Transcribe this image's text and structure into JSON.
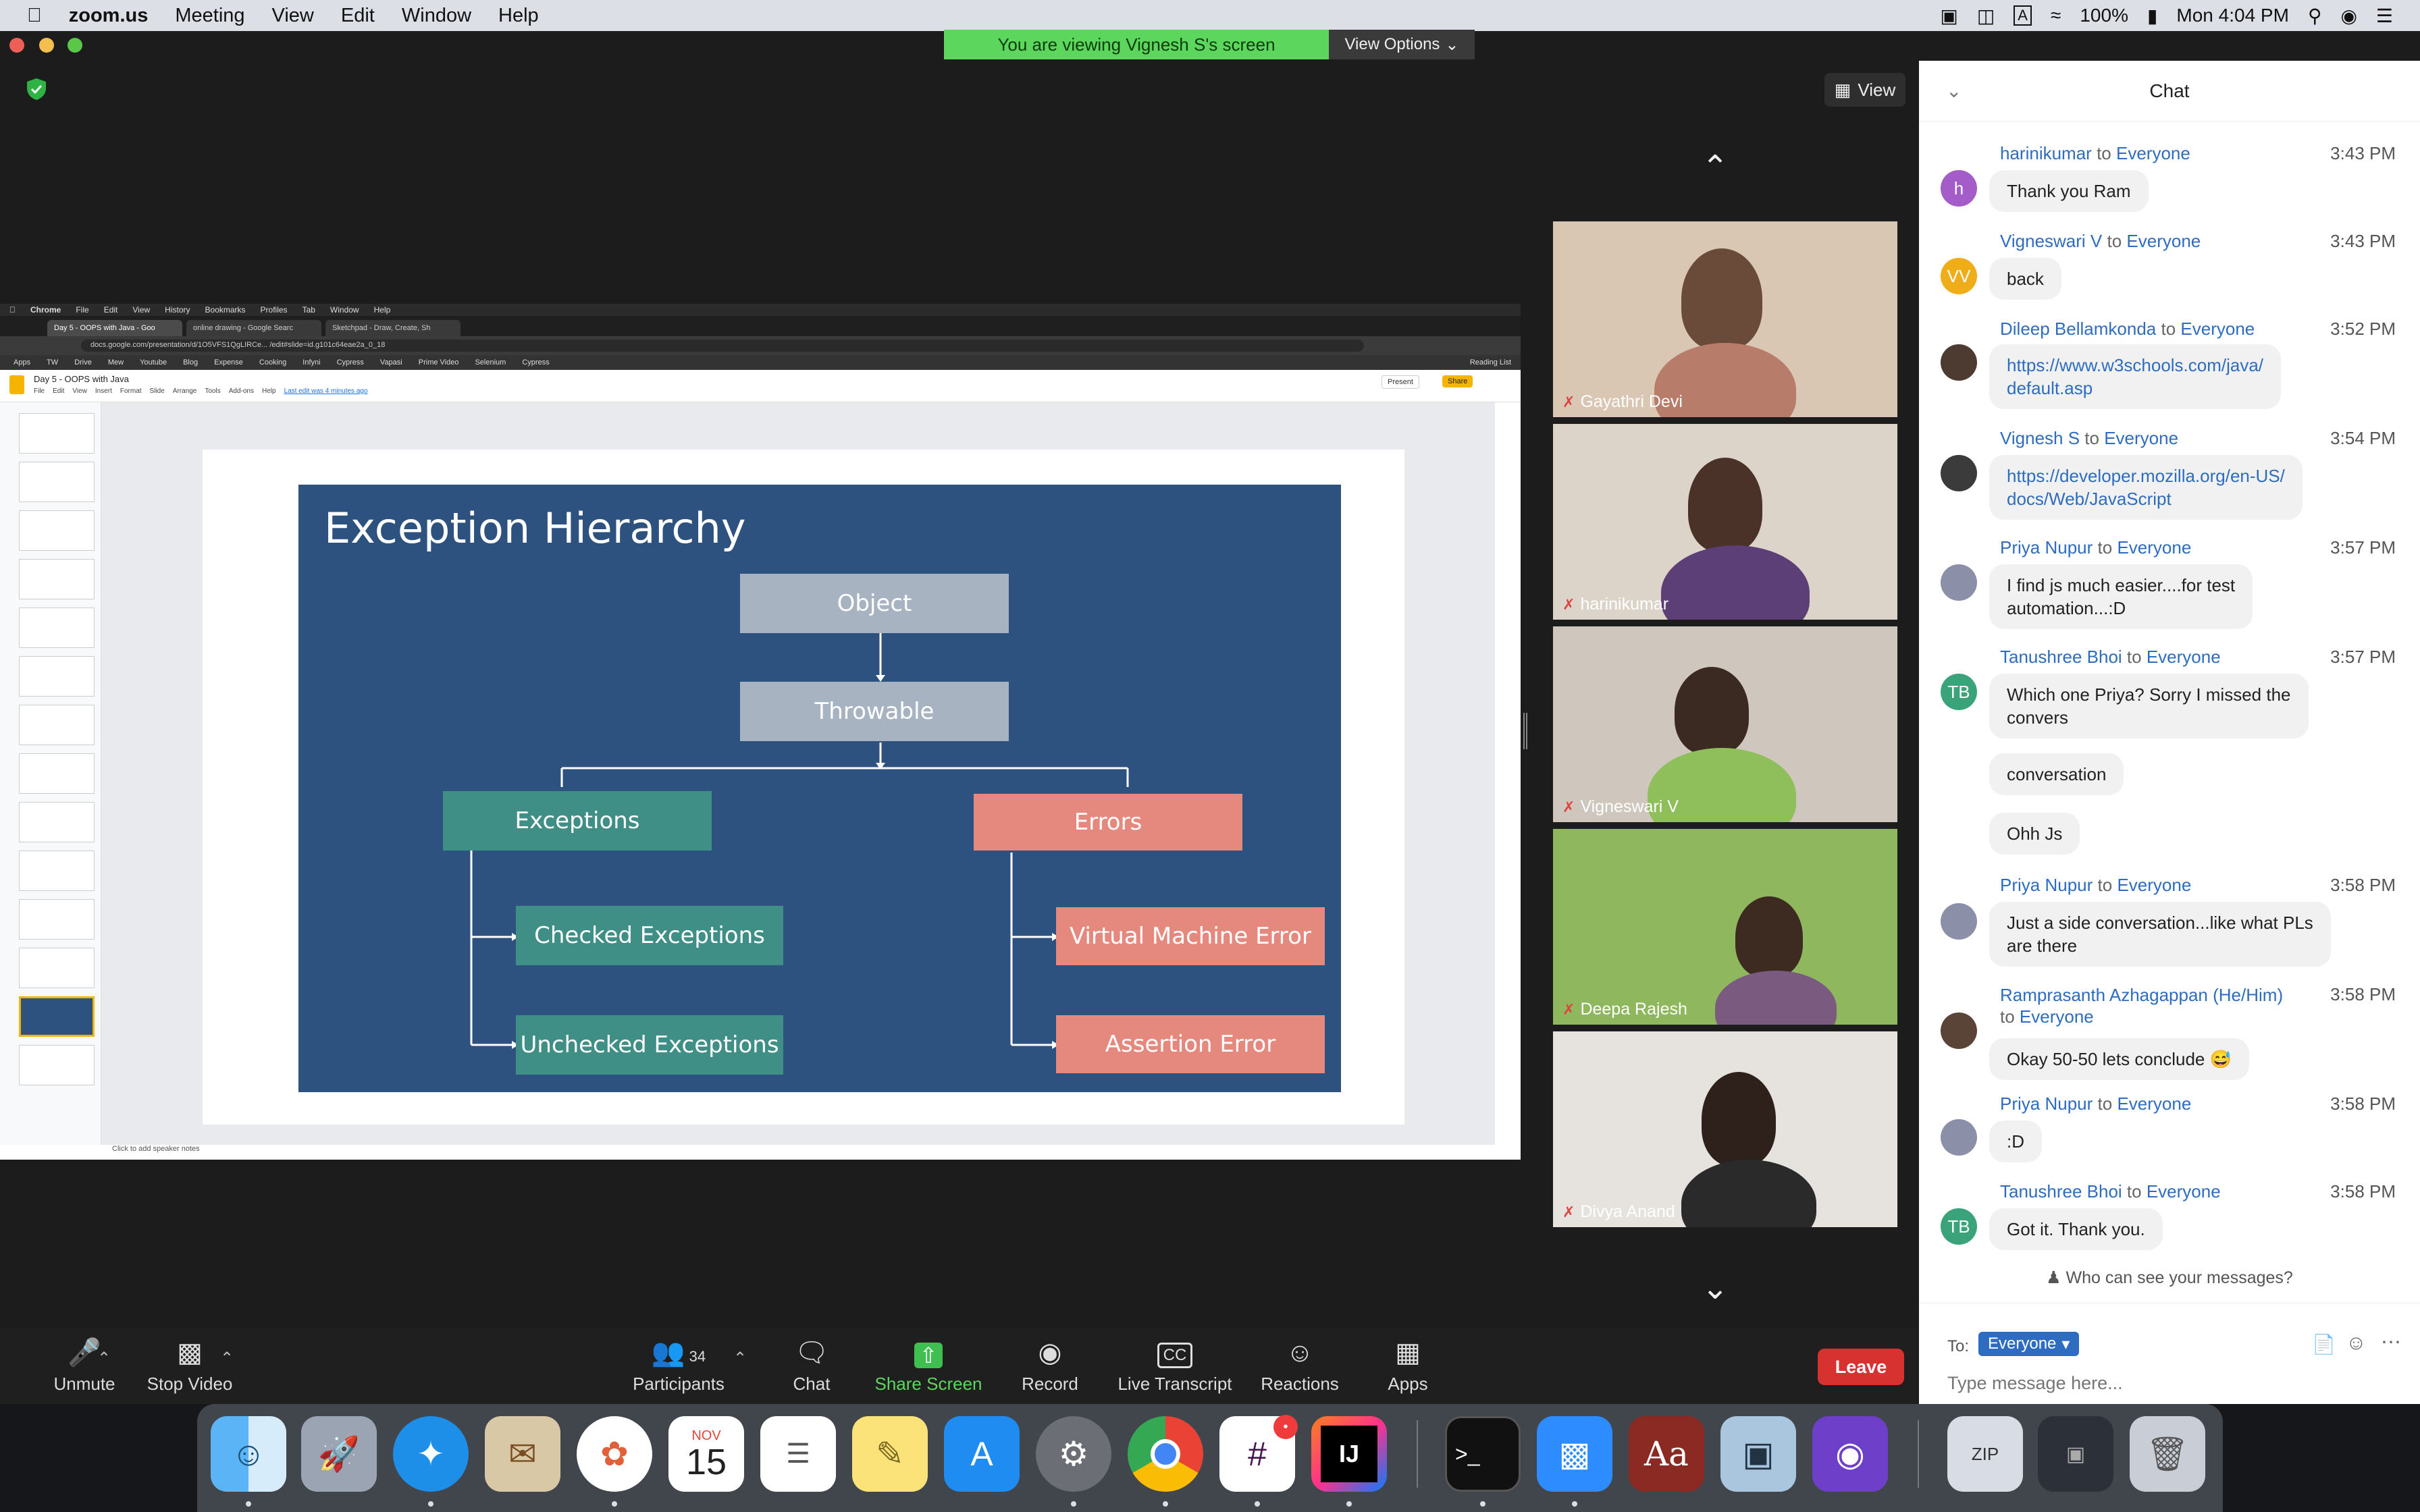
{
  "menubar": {
    "app": "zoom.us",
    "items": [
      "Meeting",
      "View",
      "Edit",
      "Window",
      "Help"
    ],
    "battery": "100%",
    "clock": "Mon 4:04 PM"
  },
  "banner": {
    "viewing": "You are viewing Vignesh S's screen",
    "view_options": "View Options"
  },
  "view_button": "View",
  "shared_screen": {
    "chrome_menu": [
      "Chrome",
      "File",
      "Edit",
      "View",
      "History",
      "Bookmarks",
      "Profiles",
      "Tab",
      "Window",
      "Help"
    ],
    "tabs": [
      "Day 5 - OOPS with Java - Goo",
      "online drawing - Google Searc",
      "Sketchpad - Draw, Create, Sh"
    ],
    "url": "docs.google.com/presentation/d/1O5VFS1QgLIRCe... /edit#slide=id.g101c64eae2a_0_18",
    "bookmarks": [
      "Apps",
      "TW",
      "Drive",
      "Mew",
      "Youtube",
      "Blog",
      "Expense",
      "Cooking",
      "Infyni",
      "Cypress",
      "Vapasi",
      "Prime Video",
      "Selenium",
      "Cypress",
      "Reading List"
    ],
    "doc_title": "Day 5 - OOPS with Java",
    "doc_menu": [
      "File",
      "Edit",
      "View",
      "Insert",
      "Format",
      "Slide",
      "Arrange",
      "Tools",
      "Add-ons",
      "Help"
    ],
    "last_edit": "Last edit was 4 minutes ago",
    "present_btn": "Present",
    "share_btn": "Share",
    "speaker_notes": "Click to add speaker notes",
    "slide": {
      "title": "Exception Hierarchy",
      "object": "Object",
      "throwable": "Throwable",
      "exceptions": "Exceptions",
      "errors": "Errors",
      "checked": "Checked Exceptions",
      "unchecked": "Unchecked Exceptions",
      "vm_error": "Virtual Machine Error",
      "assertion": "Assertion Error"
    }
  },
  "participants_tiles": [
    {
      "name": "Gayathri Devi"
    },
    {
      "name": "harinikumar"
    },
    {
      "name": "Vigneswari V"
    },
    {
      "name": "Deepa Rajesh"
    },
    {
      "name": "Divya Anand"
    }
  ],
  "chat": {
    "title": "Chat",
    "to_label": "to",
    "messages": [
      {
        "from": "harinikumar",
        "to": "Everyone",
        "time": "3:43 PM",
        "text": "Thank you Ram",
        "avatar": "h"
      },
      {
        "from": "Vigneswari V",
        "to": "Everyone",
        "time": "3:43 PM",
        "text": "back",
        "avatar": "VV"
      },
      {
        "from": "Dileep Bellamkonda",
        "to": "Everyone",
        "time": "3:52 PM",
        "text_l1": "https://www.w3schools.com/java/",
        "text_l2": "default.asp"
      },
      {
        "from": "Vignesh S",
        "to": "Everyone",
        "time": "3:54 PM",
        "text_l1": "https://developer.mozilla.org/en-US/",
        "text_l2": "docs/Web/JavaScript"
      },
      {
        "from": "Priya Nupur",
        "to": "Everyone",
        "time": "3:57 PM",
        "text_l1": "I find js much easier....for test",
        "text_l2": "automation...:D"
      },
      {
        "from": "Tanushree Bhoi",
        "to": "Everyone",
        "time": "3:57 PM",
        "text_l1": "Which one Priya? Sorry I missed the",
        "text_l2": "convers",
        "extra1": "conversation",
        "extra2": "Ohh Js",
        "avatar": "TB"
      },
      {
        "from": "Priya Nupur",
        "to": "Everyone",
        "time": "3:58 PM",
        "text_l1": "Just a side conversation...like what PLs",
        "text_l2": "are there"
      },
      {
        "from": "Ramprasanth Azhagappan (He/Him)",
        "to": "Everyone",
        "time": "3:58 PM",
        "text": "Okay 50-50 lets conclude 😅"
      },
      {
        "from": "Priya Nupur",
        "to": "Everyone",
        "time": "3:58 PM",
        "text": ":D"
      },
      {
        "from": "Tanushree Bhoi",
        "to": "Everyone",
        "time": "3:58 PM",
        "text": "Got it. Thank you.",
        "avatar": "TB"
      }
    ],
    "who_can_see": "Who can see your messages?",
    "to_prefix": "To:",
    "recipient": "Everyone",
    "placeholder": "Type message here..."
  },
  "toolbar": {
    "unmute": "Unmute",
    "stop_video": "Stop Video",
    "participants": "Participants",
    "participants_count": "34",
    "chat": "Chat",
    "share_screen": "Share Screen",
    "record": "Record",
    "live_transcript": "Live Transcript",
    "reactions": "Reactions",
    "apps": "Apps",
    "leave": "Leave"
  },
  "dock": {
    "calendar_month": "NOV",
    "calendar_day": "15",
    "slack_badge": "•"
  },
  "colors": {
    "zoom_green": "#5cd65c",
    "slide_bg": "#2d5280",
    "teal_box": "#3f8f86",
    "salmon_box": "#e5897f",
    "gray_box": "#a7b3c1",
    "leave_red": "#d7322f",
    "link_blue": "#2d6cc0"
  }
}
